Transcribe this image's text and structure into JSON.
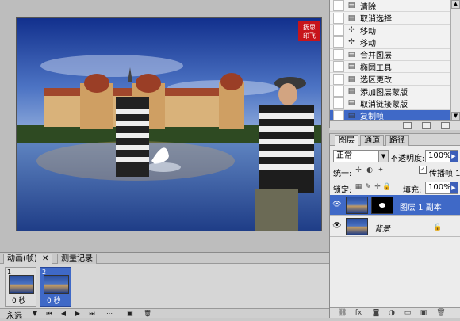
{
  "stamp": "扬思印飞",
  "history": {
    "items": [
      {
        "label": "清除",
        "icon": "history-state-icon"
      },
      {
        "label": "取消选择",
        "icon": "history-state-icon"
      },
      {
        "label": "移动",
        "icon": "move-icon"
      },
      {
        "label": "移动",
        "icon": "move-icon"
      },
      {
        "label": "合并图层",
        "icon": "history-state-icon"
      },
      {
        "label": "椭圆工具",
        "icon": "history-state-icon"
      },
      {
        "label": "选区更改",
        "icon": "history-state-icon"
      },
      {
        "label": "添加图层蒙版",
        "icon": "history-state-icon"
      },
      {
        "label": "取消链接蒙版",
        "icon": "history-state-icon"
      },
      {
        "label": "复制帧",
        "icon": "history-state-icon",
        "active": true
      }
    ]
  },
  "layers_panel": {
    "tabs": [
      "图层",
      "通道",
      "路径"
    ],
    "blend_mode": "正常",
    "opacity_label": "不透明度:",
    "opacity_value": "100%",
    "unify_label": "统一:",
    "propagate_label": "传播帧 1",
    "lock_label": "锁定:",
    "fill_label": "填充:",
    "fill_value": "100%",
    "layers": [
      {
        "name": "图层 1 副本",
        "active": true
      },
      {
        "name": "背景",
        "active": false
      }
    ]
  },
  "animation": {
    "tabs": [
      "动画(帧)",
      "测量记录"
    ],
    "frames": [
      {
        "number": "1",
        "delay": "0 秒"
      },
      {
        "number": "2",
        "delay": "0 秒",
        "active": true
      }
    ],
    "loop": "永远"
  },
  "colors": {
    "accent": "#3f69c7",
    "panel_bg": "#ececec",
    "workspace": "#bdbdbd"
  }
}
